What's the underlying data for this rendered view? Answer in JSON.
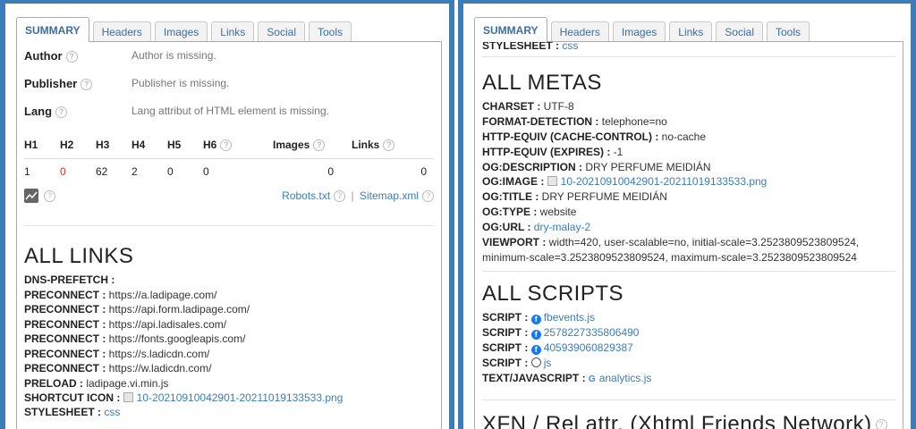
{
  "tabs": [
    "SUMMARY",
    "Headers",
    "Images",
    "Links",
    "Social",
    "Tools"
  ],
  "left": {
    "meta": [
      {
        "key": "Author",
        "value": "Author is missing."
      },
      {
        "key": "Publisher",
        "value": "Publisher is missing."
      },
      {
        "key": "Lang",
        "value": "Lang attribut of HTML element is missing."
      }
    ],
    "headings": {
      "headers": [
        "H1",
        "H2",
        "H3",
        "H4",
        "H5",
        "H6",
        "Images",
        "Links"
      ],
      "values": [
        "1",
        "0",
        "62",
        "2",
        "0",
        "0",
        "0",
        "0"
      ]
    },
    "robots": "Robots.txt",
    "sep": "|",
    "sitemap": "Sitemap.xml",
    "links_title": "ALL LINKS",
    "links": [
      {
        "k": "DNS-PREFETCH :",
        "v": ""
      },
      {
        "k": "PRECONNECT :",
        "v": " https://a.ladipage.com/"
      },
      {
        "k": "PRECONNECT :",
        "v": " https://api.form.ladipage.com/"
      },
      {
        "k": "PRECONNECT :",
        "v": " https://api.ladisales.com/"
      },
      {
        "k": "PRECONNECT :",
        "v": " https://fonts.googleapis.com/"
      },
      {
        "k": "PRECONNECT :",
        "v": " https://s.ladicdn.com/"
      },
      {
        "k": "PRECONNECT :",
        "v": " https://w.ladicdn.com/"
      },
      {
        "k": "PRELOAD :",
        "v": " ladipage.vi.min.js"
      }
    ],
    "shortcut_k": "SHORTCUT ICON :",
    "shortcut_v": "10-20210910042901-20211019133533.png",
    "stylesheet_k": "STYLESHEET :",
    "stylesheet_v": "css"
  },
  "right": {
    "top_k": "STYLESHEET :",
    "top_v": "css",
    "metas_title": "ALL METAS",
    "metas": [
      {
        "k": "CHARSET :",
        "v": " UTF-8"
      },
      {
        "k": "FORMAT-DETECTION :",
        "v": " telephone=no"
      },
      {
        "k": "HTTP-EQUIV (CACHE-CONTROL) :",
        "v": " no-cache"
      },
      {
        "k": "HTTP-EQUIV (EXPIRES) :",
        "v": " -1"
      },
      {
        "k": "OG:DESCRIPTION :",
        "v": " DRY PERFUME MEIDIÁN"
      }
    ],
    "ogimage_k": "OG:IMAGE :",
    "ogimage_v": "10-20210910042901-20211019133533.png",
    "ogtitle_k": "OG:TITLE :",
    "ogtitle_v": " DRY PERFUME MEIDIÁN",
    "ogtype_k": "OG:TYPE :",
    "ogtype_v": " website",
    "ogurl_k": "OG:URL :",
    "ogurl_v": "dry-malay-2",
    "viewport_k": "VIEWPORT :",
    "viewport_v1": " width=420, user-scalable=no, initial-scale=3.2523809523809524,",
    "viewport_v2": "minimum-scale=3.2523809523809524, maximum-scale=3.2523809523809524",
    "scripts_title": "ALL SCRIPTS",
    "scripts": [
      {
        "k": "SCRIPT :",
        "v": "fbevents.js",
        "icon": "facebook-icon"
      },
      {
        "k": "SCRIPT :",
        "v": "2578227335806490",
        "icon": "facebook-icon"
      },
      {
        "k": "SCRIPT :",
        "v": "405939060829387",
        "icon": "facebook-icon"
      },
      {
        "k": "SCRIPT :",
        "v": "js",
        "icon": "globe-icon"
      },
      {
        "k": "TEXT/JAVASCRIPT :",
        "v": "analytics.js",
        "icon": "google-icon"
      }
    ],
    "xfn_title": "XFN / Rel attr. (Xhtml Friends Network)"
  }
}
